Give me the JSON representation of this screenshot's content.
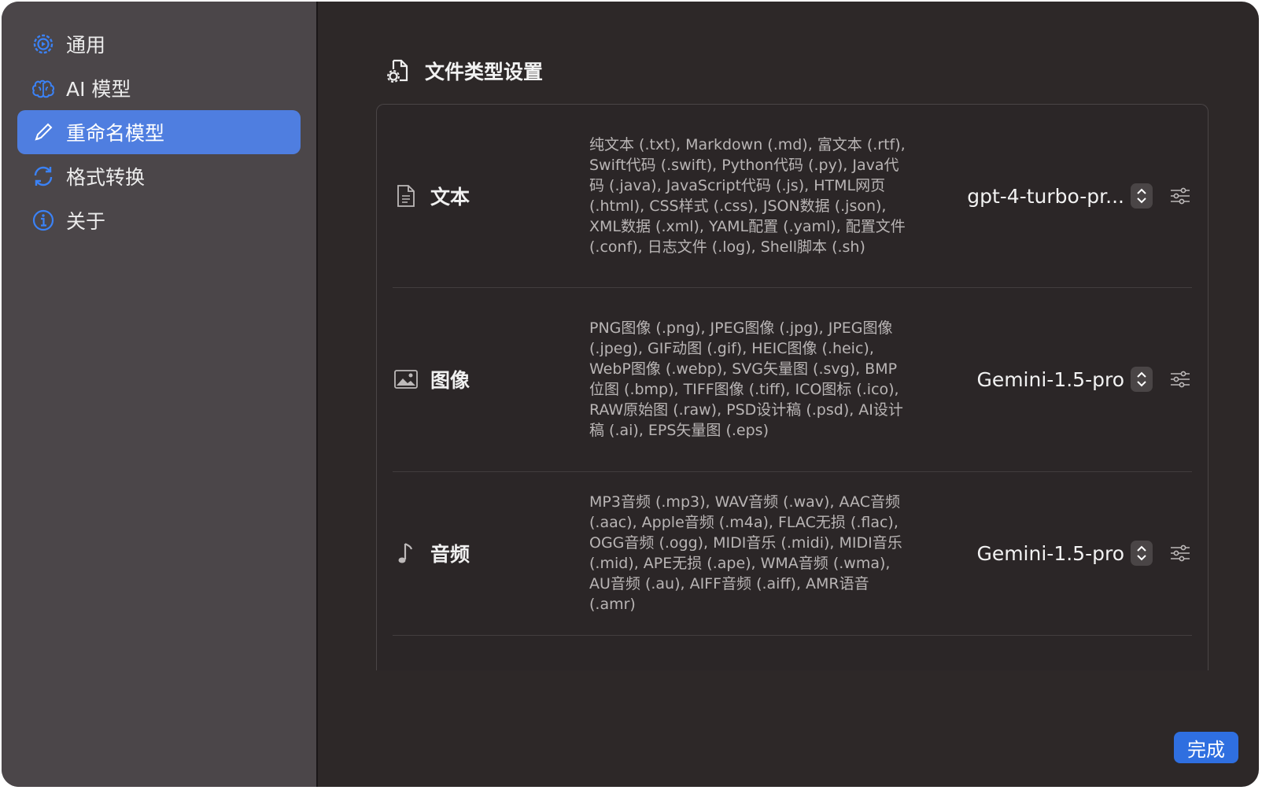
{
  "sidebar": {
    "items": [
      {
        "label": "通用",
        "icon": "gear-icon",
        "active": false
      },
      {
        "label": "AI 模型",
        "icon": "brain-icon",
        "active": false
      },
      {
        "label": "重命名模型",
        "icon": "pencil-icon",
        "active": true
      },
      {
        "label": "格式转换",
        "icon": "sync-icon",
        "active": false
      },
      {
        "label": "关于",
        "icon": "info-icon",
        "active": false
      }
    ]
  },
  "main": {
    "title": "文件类型设置",
    "title_icon": "file-gear-icon",
    "rows": [
      {
        "type_label": "文本",
        "icon": "document-icon",
        "description": "纯文本 (.txt), Markdown (.md), 富文本 (.rtf), Swift代码 (.swift), Python代码 (.py), Java代码 (.java), JavaScript代码 (.js), HTML网页 (.html), CSS样式 (.css), JSON数据 (.json), XML数据 (.xml), YAML配置 (.yaml), 配置文件 (.conf), 日志文件 (.log), Shell脚本 (.sh)",
        "model": "gpt-4-turbo-pr..."
      },
      {
        "type_label": "图像",
        "icon": "photo-icon",
        "description": "PNG图像 (.png), JPEG图像 (.jpg), JPEG图像 (.jpeg), GIF动图 (.gif), HEIC图像 (.heic), WebP图像 (.webp), SVG矢量图 (.svg), BMP位图 (.bmp), TIFF图像 (.tiff), ICO图标 (.ico), RAW原始图 (.raw), PSD设计稿 (.psd), AI设计稿 (.ai), EPS矢量图 (.eps)",
        "model": "Gemini-1.5-pro"
      },
      {
        "type_label": "音频",
        "icon": "music-note-icon",
        "description": "MP3音频 (.mp3), WAV音频 (.wav), AAC音频 (.aac), Apple音频 (.m4a), FLAC无损 (.flac), OGG音频 (.ogg), MIDI音乐 (.midi), MIDI音乐 (.mid), APE无损 (.ape), WMA音频 (.wma), AU音频 (.au), AIFF音频 (.aiff), AMR语音 (.amr)",
        "model": "Gemini-1.5-pro"
      }
    ]
  },
  "footer": {
    "done_label": "完成"
  },
  "colors": {
    "accent": "#4f7ee0",
    "button": "#2f6fe0",
    "icon_blue": "#3b82f6"
  }
}
